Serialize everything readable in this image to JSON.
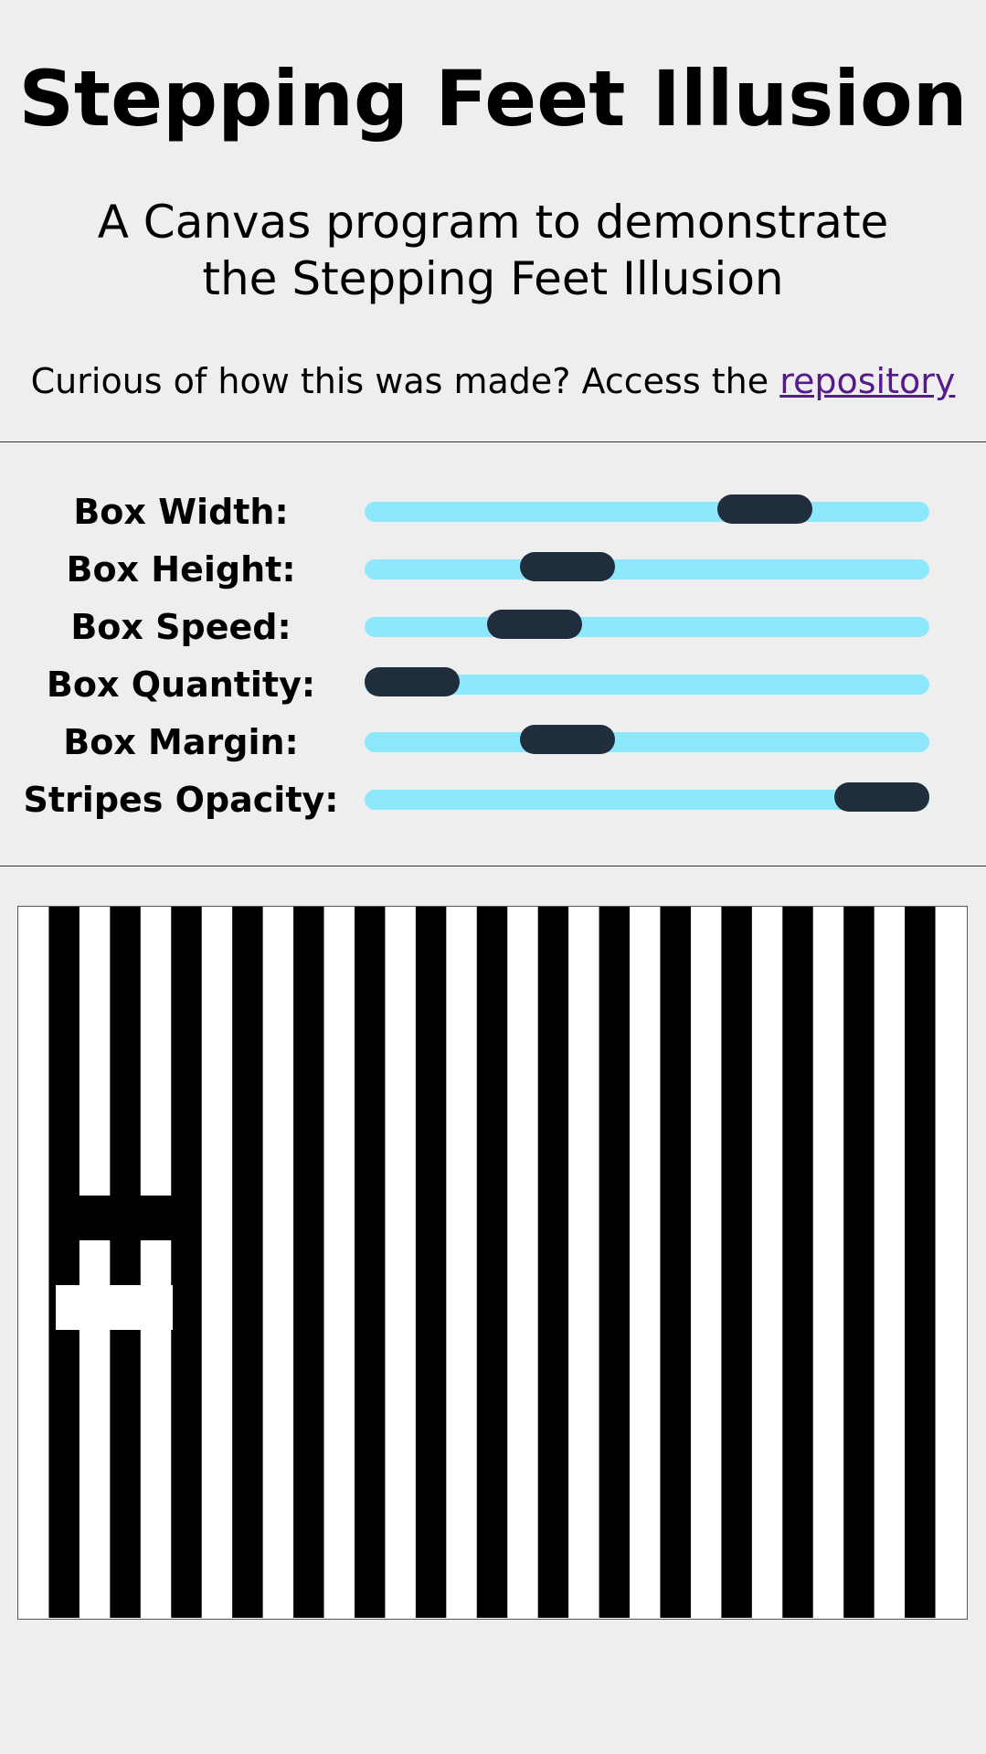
{
  "page": {
    "title": "Stepping Feet Illusion",
    "subtitle": "A Canvas program to demonstrate the Stepping Feet Illusion",
    "repo_prefix": "Curious of how this was made? Access the",
    "repo_link": "repository"
  },
  "controls": [
    {
      "label": "Box Width:",
      "value": 0.75
    },
    {
      "label": "Box Height:",
      "value": 0.33
    },
    {
      "label": "Box Speed:",
      "value": 0.26
    },
    {
      "label": "Box Quantity:",
      "value": 0.0
    },
    {
      "label": "Box Margin:",
      "value": 0.33
    },
    {
      "label": "Stripes Opacity:",
      "value": 1.0
    }
  ],
  "colors": {
    "background": "#eeeeee",
    "link": "#551a8b",
    "slider_track": "#8ee8fb",
    "slider_thumb": "#1f2d3d",
    "stripe_dark": "#000000",
    "stripe_light": "#ffffff"
  },
  "canvas": {
    "stripe_count": 31
  }
}
